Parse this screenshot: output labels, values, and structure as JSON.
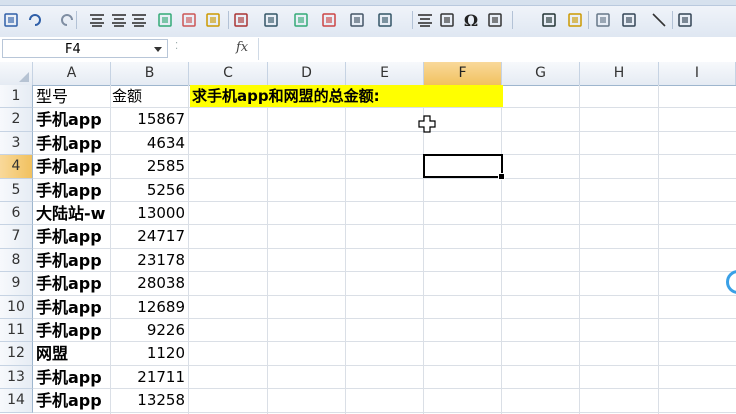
{
  "name_box": {
    "value": "F4"
  },
  "formula_bar": {
    "fx_label": "fx",
    "value": ""
  },
  "columns": [
    "A",
    "B",
    "C",
    "D",
    "E",
    "F",
    "G",
    "H",
    "I"
  ],
  "active_column": "F",
  "active_row": "4",
  "rows": [
    {
      "num": "1",
      "a": "型号",
      "b": "金额"
    },
    {
      "num": "2",
      "a": "手机app",
      "b": "15867"
    },
    {
      "num": "3",
      "a": "手机app",
      "b": "4634"
    },
    {
      "num": "4",
      "a": "手机app",
      "b": "2585"
    },
    {
      "num": "5",
      "a": "手机app",
      "b": "5256"
    },
    {
      "num": "6",
      "a": "大陆站-w",
      "b": "13000"
    },
    {
      "num": "7",
      "a": "手机app",
      "b": "24717"
    },
    {
      "num": "8",
      "a": "手机app",
      "b": "23178"
    },
    {
      "num": "9",
      "a": "手机app",
      "b": "28038"
    },
    {
      "num": "10",
      "a": "手机app",
      "b": "12689"
    },
    {
      "num": "11",
      "a": "手机app",
      "b": "9226"
    },
    {
      "num": "12",
      "a": "网盟",
      "b": "1120"
    },
    {
      "num": "13",
      "a": "手机app",
      "b": "21711"
    },
    {
      "num": "14",
      "a": "手机app",
      "b": "13258"
    }
  ],
  "banner": {
    "text": "求手机app和网盟的总金额:",
    "color": "#ffff00"
  },
  "colors": {
    "accent": "#f1c15f",
    "grid_line": "#dadfe6",
    "selection": "#000000"
  },
  "toolbar_icons": [
    "save-icon",
    "undo-icon",
    "redo-icon",
    "align-left-icon",
    "align-center-icon",
    "align-right-icon",
    "merge-cells-icon",
    "format-icon",
    "fill-color-icon",
    "font-color-icon",
    "find-icon",
    "insert-icon",
    "delete-icon",
    "format-cells-icon",
    "sort-icon",
    "indent-icon",
    "chart-icon",
    "omega-icon",
    "abc-icon",
    "new-sheet-icon",
    "checkbox-icon",
    "shapes-icon",
    "camera-icon",
    "line-icon",
    "group-icon"
  ]
}
